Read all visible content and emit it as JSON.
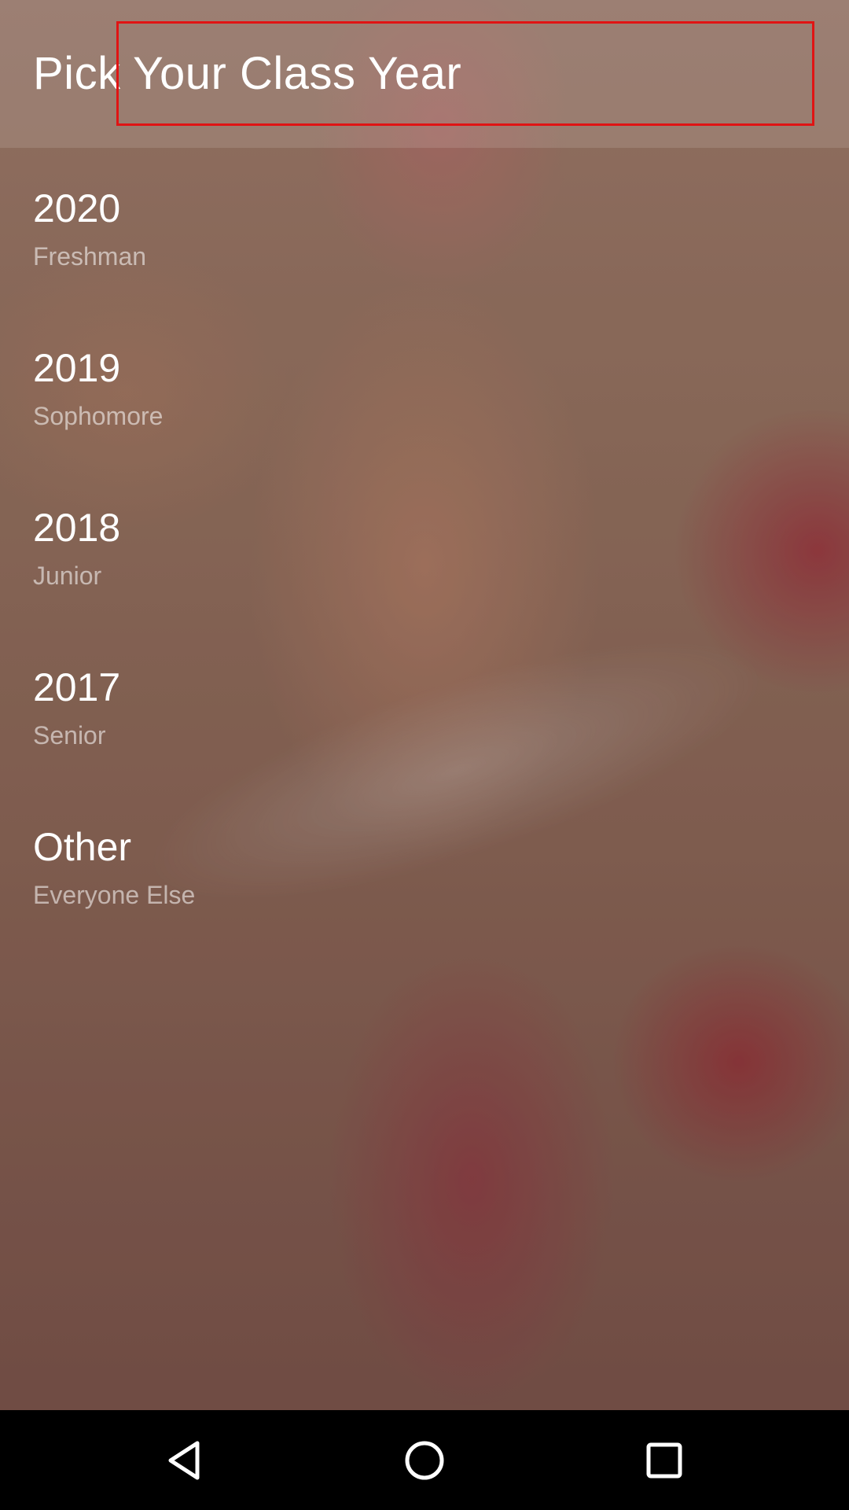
{
  "header": {
    "title": "Pick Your Class Year"
  },
  "list": {
    "items": [
      {
        "title": "2020",
        "subtitle": "Freshman"
      },
      {
        "title": "2019",
        "subtitle": "Sophomore"
      },
      {
        "title": "2018",
        "subtitle": "Junior"
      },
      {
        "title": "2017",
        "subtitle": "Senior"
      },
      {
        "title": "Other",
        "subtitle": "Everyone Else"
      }
    ]
  },
  "navigation_bar": {
    "buttons": [
      {
        "icon": "back-triangle-icon"
      },
      {
        "icon": "home-circle-icon"
      },
      {
        "icon": "recents-square-icon"
      }
    ]
  },
  "colors": {
    "highlight_box": "#e01414",
    "text_primary": "#ffffff",
    "navbar_background": "#000000"
  }
}
